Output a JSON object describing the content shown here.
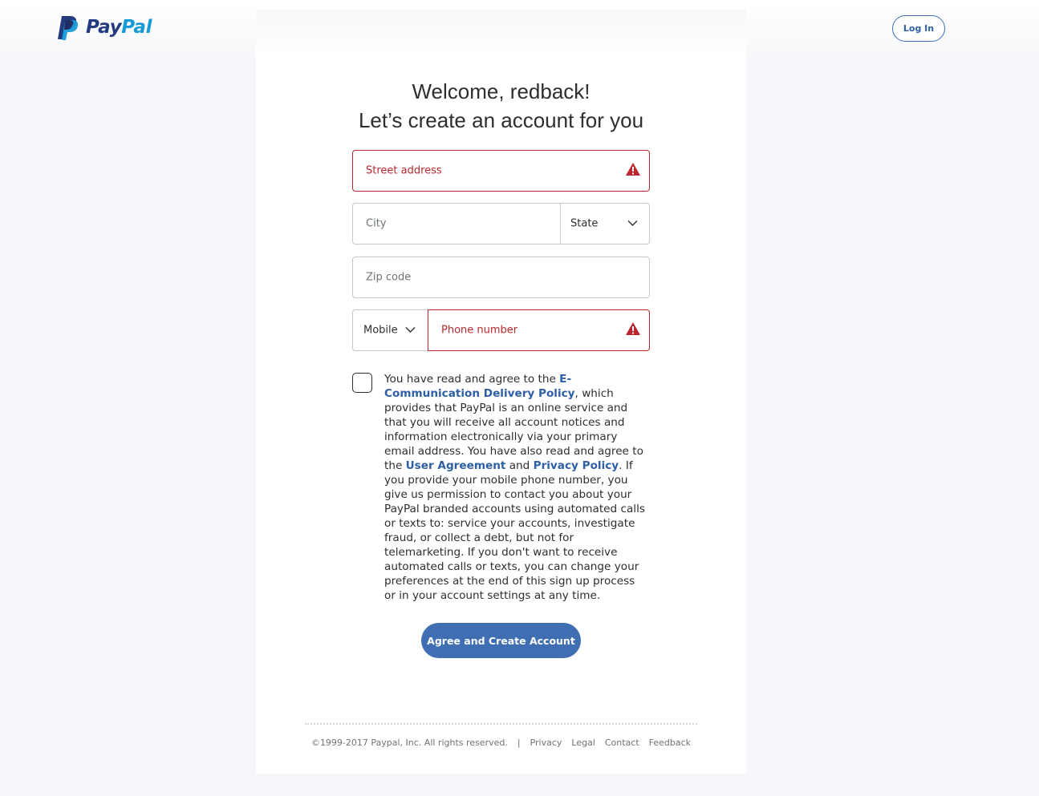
{
  "header": {
    "logo_text_pay": "Pay",
    "logo_text_pal": "Pal",
    "login_label": "Log In"
  },
  "welcome": {
    "line1": "Welcome, redback!",
    "line2": "Let’s create an account for you"
  },
  "form": {
    "street_placeholder": "Street address",
    "city_placeholder": "City",
    "state_label": "State",
    "zip_placeholder": "Zip code",
    "phone_type_label": "Mobile",
    "phone_placeholder": "Phone number"
  },
  "consent": {
    "t1": "You have read and agree to the ",
    "link_ecomm": "E-Communication Delivery Policy",
    "t2": ", which provides that PayPal is an online service and that you will receive all account notices and information electronically via your primary email address. You have also read and agree to the ",
    "link_user": "User Agreement",
    "t3": " and ",
    "link_privacy": "Privacy Policy",
    "t4": ". If you provide your mobile phone number, you give us permission to contact you about your PayPal branded accounts using automated calls or texts to: service your accounts, investigate fraud, or collect a debt, but not for telemarketing. If you don't want to receive automated calls or texts, you can change your preferences at the end of this sign up process or in your account settings at any time."
  },
  "cta_label": "Agree and Create Account",
  "footer": {
    "copyright": "©1999-2017 Paypal, Inc. All rights reserved.",
    "separator": "|",
    "privacy": "Privacy",
    "legal": "Legal",
    "contact": "Contact",
    "feedback": "Feedback"
  },
  "colors": {
    "primary": "#3f6eb2",
    "link": "#2c5fa6",
    "error": "#b9272c",
    "background": "#f5f7fa"
  },
  "icons": [
    "paypal-logo-icon",
    "warning-icon",
    "chevron-down-icon"
  ]
}
